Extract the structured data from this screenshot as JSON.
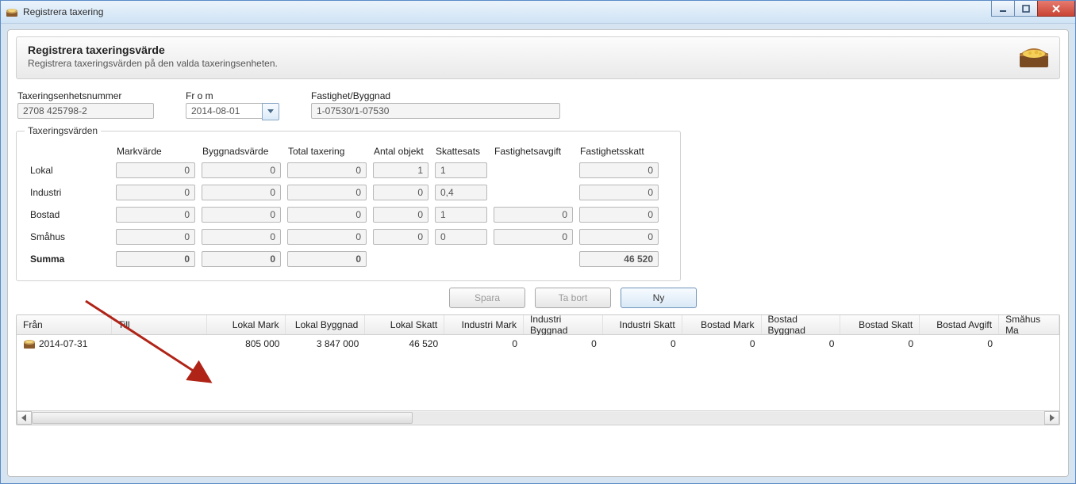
{
  "window": {
    "title": "Registrera taxering"
  },
  "header": {
    "title": "Registrera taxeringsvärde",
    "subtitle": "Registrera taxeringsvärden på den valda taxeringsenheten."
  },
  "fields": {
    "unit_label": "Taxeringsenhetsnummer",
    "unit_value": "2708 425798-2",
    "from_label": "Fr o m",
    "from_value": "2014-08-01",
    "property_label": "Fastighet/Byggnad",
    "property_value": "1-07530/1-07530"
  },
  "taxgroup": {
    "legend": "Taxeringsvärden",
    "cols": {
      "mark": "Markvärde",
      "bygg": "Byggnadsvärde",
      "total": "Total taxering",
      "antal": "Antal objekt",
      "skattesats": "Skattesats",
      "avgift": "Fastighetsavgift",
      "skatt": "Fastighetsskatt"
    },
    "rows": {
      "lokal": {
        "label": "Lokal",
        "mark": "0",
        "bygg": "0",
        "total": "0",
        "antal": "1",
        "sats": "1",
        "avgift": "",
        "skatt": "0"
      },
      "industri": {
        "label": "Industri",
        "mark": "0",
        "bygg": "0",
        "total": "0",
        "antal": "0",
        "sats": "0,4",
        "avgift": "",
        "skatt": "0"
      },
      "bostad": {
        "label": "Bostad",
        "mark": "0",
        "bygg": "0",
        "total": "0",
        "antal": "0",
        "sats": "1",
        "avgift": "0",
        "skatt": "0"
      },
      "smahus": {
        "label": "Småhus",
        "mark": "0",
        "bygg": "0",
        "total": "0",
        "antal": "0",
        "sats": "0",
        "avgift": "0",
        "skatt": "0"
      },
      "summa": {
        "label": "Summa",
        "mark": "0",
        "bygg": "0",
        "total": "0",
        "skatt": "46 520"
      }
    }
  },
  "buttons": {
    "save": "Spara",
    "delete": "Ta bort",
    "new": "Ny"
  },
  "list": {
    "headers": {
      "from": "Från",
      "till": "Till",
      "lokal_mark": "Lokal Mark",
      "lokal_bygg": "Lokal Byggnad",
      "lokal_skatt": "Lokal Skatt",
      "ind_mark": "Industri Mark",
      "ind_bygg": "Industri Byggnad",
      "ind_skatt": "Industri Skatt",
      "bo_mark": "Bostad Mark",
      "bo_bygg": "Bostad Byggnad",
      "bo_skatt": "Bostad Skatt",
      "bo_avgift": "Bostad Avgift",
      "sm_mark": "Småhus Ma"
    },
    "row": {
      "from": "2014-07-31",
      "till": "",
      "lokal_mark": "805 000",
      "lokal_bygg": "3 847 000",
      "lokal_skatt": "46 520",
      "ind_mark": "0",
      "ind_bygg": "0",
      "ind_skatt": "0",
      "bo_mark": "0",
      "bo_bygg": "0",
      "bo_skatt": "0",
      "bo_avgift": "0"
    }
  }
}
